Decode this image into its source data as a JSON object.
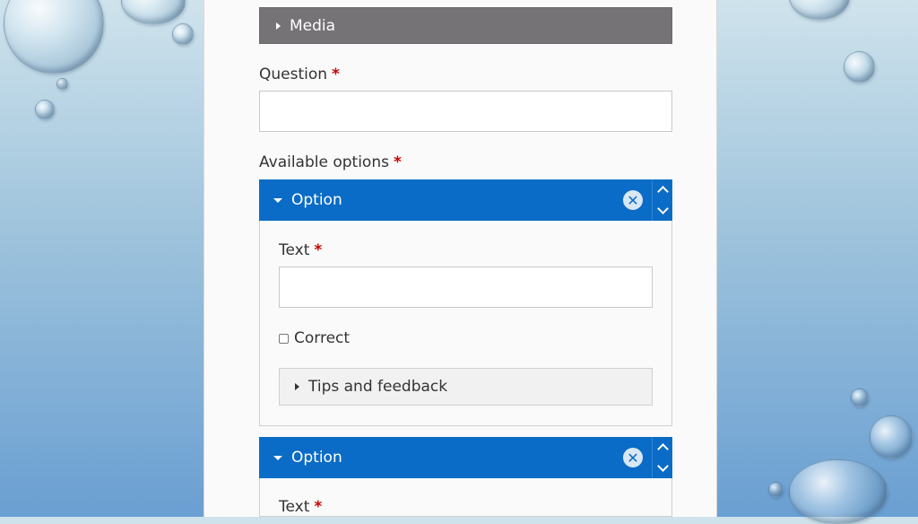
{
  "media": {
    "label": "Media"
  },
  "question": {
    "label": "Question",
    "required": "*",
    "value": ""
  },
  "options_section": {
    "label": "Available options",
    "required": "*"
  },
  "options": [
    {
      "title": "Option",
      "remove_icon": "close-circle-icon",
      "text_label": "Text",
      "text_required": "*",
      "text_value": "",
      "correct_label": "Correct",
      "correct_checked": false,
      "tips_label": "Tips and feedback"
    },
    {
      "title": "Option",
      "remove_icon": "close-circle-icon",
      "text_label": "Text",
      "text_required": "*"
    }
  ],
  "colors": {
    "option_header": "#0a6cc6",
    "media_bar": "#757375",
    "required": "#cc0000"
  }
}
